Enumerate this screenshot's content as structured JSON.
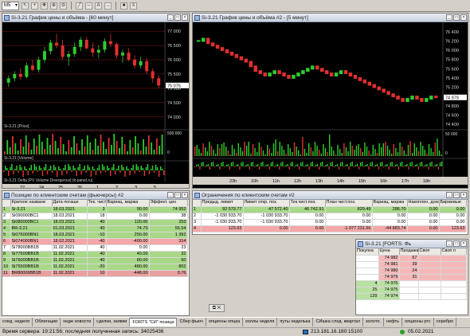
{
  "toolbar": {
    "interval": "M5"
  },
  "chart1": {
    "title": "Si-3.21 График цены и объёма - [60 минут]",
    "price_axis": [
      "77 000",
      "76 500",
      "76 000",
      "75 500",
      "75 000",
      "74 500",
      "74 000"
    ],
    "last_tag": "75 075",
    "price_panel_label": "Si-3.21 [Price]",
    "volume_panel_label": "Si-3.21 [Volume]",
    "volume_axis": [
      "500 000",
      "0"
    ],
    "delta_panel_label": "Si-3.21 Delta [PV Volume Divergence] (k-panel.ru)",
    "x_labels": [
      "22",
      "24",
      "25",
      "26",
      "1",
      "2",
      "3",
      "5"
    ],
    "x_month": "Feb",
    "chart_data": {
      "type": "candlestick",
      "title": "Si-3.21 График цены и объёма - [60 минут]",
      "ylim": [
        73800,
        77200
      ],
      "ohlc": [
        [
          75200,
          75450,
          75050,
          75350
        ],
        [
          75350,
          75600,
          75250,
          75500
        ],
        [
          75500,
          75700,
          75300,
          75400
        ],
        [
          75400,
          75900,
          75350,
          75800
        ],
        [
          75800,
          76000,
          75600,
          75650
        ],
        [
          75650,
          76100,
          75550,
          76000
        ],
        [
          76000,
          76450,
          75900,
          76300
        ],
        [
          76300,
          76700,
          76200,
          76600
        ],
        [
          76600,
          76900,
          76400,
          76500
        ],
        [
          76500,
          76700,
          76000,
          76100
        ],
        [
          76100,
          76300,
          75800,
          76200
        ],
        [
          76200,
          76600,
          76100,
          76450
        ],
        [
          76450,
          76800,
          76300,
          76700
        ],
        [
          76700,
          76800,
          76350,
          76400
        ],
        [
          76400,
          76600,
          76100,
          76250
        ],
        [
          76250,
          76500,
          76050,
          76350
        ],
        [
          76350,
          76750,
          76250,
          76650
        ],
        [
          76650,
          76900,
          76450,
          76550
        ],
        [
          76550,
          76600,
          76050,
          76150
        ],
        [
          76150,
          76350,
          75900,
          76250
        ],
        [
          76250,
          76400,
          75950,
          76000
        ],
        [
          76000,
          76150,
          75700,
          75800
        ],
        [
          75800,
          76100,
          75700,
          75950
        ],
        [
          75950,
          76050,
          75500,
          75600
        ],
        [
          75600,
          75700,
          75200,
          75350
        ],
        [
          75350,
          75450,
          75000,
          75100
        ]
      ]
    }
  },
  "chart2": {
    "title": "Si-3.21 График цены и объёма #2 - [5 минут]",
    "price_axis": [
      "76 400",
      "76 200",
      "76 000",
      "75 800",
      "75 600",
      "75 400",
      "75 200",
      "75 000",
      "74 800",
      "74 600",
      "74 400"
    ],
    "last_tag": "74 979",
    "volume_axis": [
      "50 000",
      "0"
    ],
    "x_labels": [
      "23h",
      "10h",
      "11h",
      "12h",
      "13h",
      "14h",
      "15h",
      "16h",
      "17h",
      "18h"
    ],
    "chart_data": {
      "type": "line",
      "title": "Si-3.21 График цены и объёма #2 - [5 минут]",
      "ylim": [
        74400,
        76500
      ],
      "y": [
        76200,
        76250,
        76150,
        76100,
        76050,
        76000,
        75950,
        75900,
        75850,
        75800,
        75750,
        75650,
        75550,
        75500,
        75450,
        75500,
        75550,
        75500,
        75450,
        75400,
        75450,
        75500,
        75550,
        75600,
        75650,
        75600,
        75550,
        75500,
        75450,
        75500,
        75550,
        75500,
        75450,
        75400,
        75350,
        75300,
        75250,
        75200,
        75150,
        75100,
        75050,
        75000,
        74950,
        74900,
        74950,
        75000,
        74950,
        74900,
        74950,
        75000,
        74980
      ]
    }
  },
  "positions": {
    "title": "Позиции по клиентским счетам (фьючерсы) #2",
    "headers": [
      "Краткое названи",
      "Дата погаше",
      "Тек. чист",
      "Вариац. маржа",
      "Эффект. цен"
    ],
    "rows": [
      {
        "n": "1",
        "name": "Si-3.21",
        "date": "18.03.2021",
        "pos": "3",
        "var": "90.00",
        "price": "74 952",
        "color": "#a8d888"
      },
      {
        "n": "2",
        "name": "Si090000BC1",
        "date": "18.03.2021",
        "pos": "18",
        "var": "0.00",
        "price": "38",
        "color": "#ffffff"
      },
      {
        "n": "3",
        "name": "Si080000BC1",
        "date": "18.03.2021",
        "pos": "40",
        "var": "120.00",
        "price": "253",
        "color": "#a8d888"
      },
      {
        "n": "4",
        "name": "BR-3.21",
        "date": "01.03.2021",
        "pos": "40",
        "var": "74.70",
        "price": "55.54",
        "color": "#a8d888"
      },
      {
        "n": "5",
        "name": "Si076000BN1",
        "date": "18.03.2021",
        "pos": "-10",
        "var": "250.00",
        "price": "1 392",
        "color": "#a8d888"
      },
      {
        "n": "6",
        "name": "Si074000BN1",
        "date": "18.02.2021",
        "pos": "-40",
        "var": "-400.00",
        "price": "314",
        "color": "#f4a8a8"
      },
      {
        "n": "7",
        "name": "Si78000BB1B",
        "date": "11.02.2021",
        "pos": "40",
        "var": "0.00",
        "price": "23",
        "color": "#ffffff"
      },
      {
        "n": "8",
        "name": "Si77500BB1B",
        "date": "11.02.2021",
        "pos": "40",
        "var": "40.00",
        "price": "32",
        "color": "#a8d888"
      },
      {
        "n": "9",
        "name": "Si76000BB1B",
        "date": "11.02.2021",
        "pos": "40",
        "var": "80.00",
        "price": "50",
        "color": "#a8d888"
      },
      {
        "n": "10",
        "name": "Si75500BB1B",
        "date": "11.02.2021",
        "pos": "-20",
        "var": "480.00",
        "price": "802",
        "color": "#a8d888"
      },
      {
        "n": "11",
        "name": "BR80006BB1B",
        "date": "11.02.2021",
        "pos": "10",
        "var": "-448.00",
        "price": "0.76",
        "color": "#e8a0a0"
      }
    ]
  },
  "limits": {
    "title": "Ограничения по клиентским счетам #2",
    "headers": [
      "Предыд. лимит",
      "Лимит откр. поз.",
      "Тек.чист.поз.",
      "План чист.поз.",
      "Вариац. маржа",
      "Накоплен. доход",
      "Биржевые"
    ],
    "rows": [
      {
        "n": "1",
        "c": [
          "92 579.77",
          "47 572.40",
          "46 742.91",
          "829.49",
          "286.70",
          "0.00",
          "0.00"
        ],
        "color": "#a8d888"
      },
      {
        "n": "2",
        "c": [
          "-1 030 933.70",
          "-1 030 933.70",
          "0.00",
          "0.00",
          "0.00",
          "0.00",
          "0.00"
        ],
        "color": "#ffffff"
      },
      {
        "n": "3",
        "c": [
          "-1 030 933.70",
          "-1 030 933.70",
          "0.00",
          "0.00",
          "0.00",
          "0.00",
          "0.00"
        ],
        "color": "#ffffff"
      },
      {
        "n": "4",
        "c": [
          "123.63",
          "0.00",
          "0.00",
          "-1 077 231.56",
          "-44 883.74",
          "0.00",
          "123.63"
        ],
        "color": "#f4a8a8"
      }
    ]
  },
  "orderbook": {
    "title": "Si-3.21 [FORTS: Фь",
    "headers": [
      "Покупка",
      "Цена",
      "Продажа",
      "Своп",
      "Своп п"
    ],
    "rows": [
      {
        "buy": "",
        "price": "74 982",
        "sell": "67",
        "color": "#f4b8b8"
      },
      {
        "buy": "",
        "price": "74 981",
        "sell": "39",
        "color": "#f4b8b8"
      },
      {
        "buy": "",
        "price": "74 980",
        "sell": "24",
        "color": "#f4b8b8"
      },
      {
        "buy": "",
        "price": "74 979",
        "sell": "31",
        "color": "#f4b8b8"
      },
      {
        "buy": "4",
        "price": "74 976",
        "sell": "",
        "color": "#b8e0a0"
      },
      {
        "buy": "25",
        "price": "74 975",
        "sell": "",
        "color": "#b8e0a0"
      },
      {
        "buy": "129",
        "price": "74 974",
        "sell": "",
        "color": "#b8e0a0"
      }
    ]
  },
  "tabs": [
    "след. неделя",
    "Облигации",
    "хедж новости",
    "сделки, заявки",
    "FORTS \"СИ\" позици",
    "Сбер фьюч",
    "опционы опцка",
    "коллы неделя",
    "путы неделька",
    "СИшка след. квартал",
    "золото.",
    "нефть",
    "опционы ртс",
    "серебро"
  ],
  "status": {
    "text": "Время сервера: 19:21:56; последняя полученная запись: 34025436",
    "ip": "213.181.16.180:15100",
    "date": "05.02.2021"
  }
}
